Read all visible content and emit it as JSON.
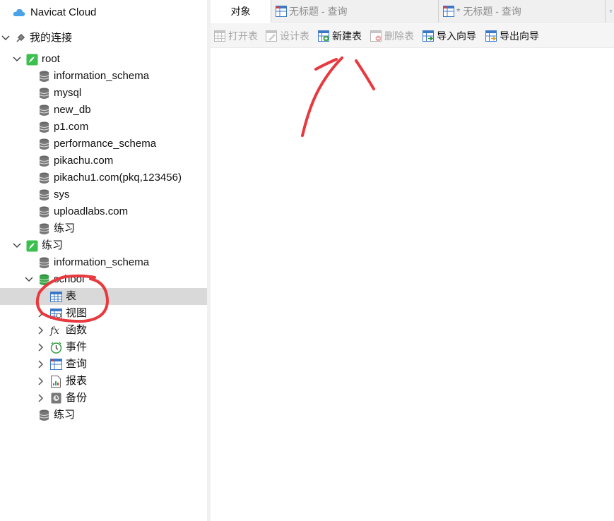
{
  "nav": {
    "header": "Navicat Cloud",
    "my_connections": "我的连接",
    "connections": [
      {
        "name": "root",
        "databases": [
          "information_schema",
          "mysql",
          "new_db",
          "p1.com",
          "performance_schema",
          "pikachu.com",
          "pikachu1.com(pkq,123456)",
          "sys",
          "uploadlabs.com",
          "练习"
        ]
      },
      {
        "name": "练习",
        "databases": [
          "information_schema"
        ],
        "open_database": {
          "name": "school",
          "children": [
            "表",
            "视图",
            "函数",
            "事件",
            "查询",
            "报表",
            "备份"
          ]
        },
        "databases_after": [
          "练习"
        ]
      }
    ]
  },
  "tabs": [
    {
      "label": "对象",
      "prefix": ""
    },
    {
      "label": "无标题 - 查询",
      "prefix": ""
    },
    {
      "label": "无标题 - 查询",
      "prefix": "* "
    }
  ],
  "toolbar": {
    "open": "打开表",
    "design": "设计表",
    "new": "新建表",
    "delete": "删除表",
    "import": "导入向导",
    "export": "导出向导"
  },
  "colors": {
    "selected_row": "#d9d9d9",
    "annotation": "#e8393f",
    "connection_icon": "#3bbf4f",
    "database_icon": "#666666",
    "open_database_icon": "#3aa64a"
  }
}
